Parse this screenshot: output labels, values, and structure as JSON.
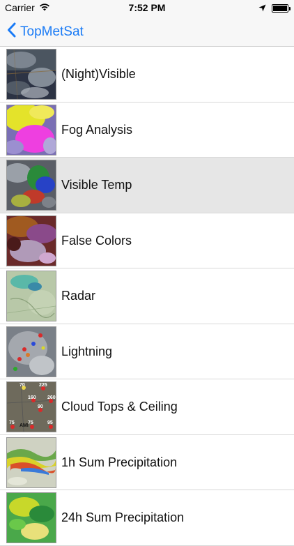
{
  "status_bar": {
    "carrier": "Carrier",
    "time": "7:52 PM",
    "icons": [
      "wifi-icon",
      "location-arrow-icon",
      "battery-icon"
    ]
  },
  "nav": {
    "back_label": "TopMetSat",
    "accent_color": "#1a7bf6"
  },
  "list": {
    "items": [
      {
        "label": "(Night)Visible",
        "selected": false
      },
      {
        "label": "Fog Analysis",
        "selected": false
      },
      {
        "label": "Visible Temp",
        "selected": true
      },
      {
        "label": "False Colors",
        "selected": false
      },
      {
        "label": "Radar",
        "selected": false
      },
      {
        "label": "Lightning",
        "selected": false
      },
      {
        "label": "Cloud Tops & Ceiling",
        "selected": false
      },
      {
        "label": "1h Sum Precipitation",
        "selected": false
      },
      {
        "label": "24h Sum Precipitation",
        "selected": false
      }
    ],
    "cloud_tops_thumb_values": [
      "70",
      "225",
      "160",
      "260",
      "90",
      "75",
      "75",
      "95",
      "AMI"
    ]
  }
}
